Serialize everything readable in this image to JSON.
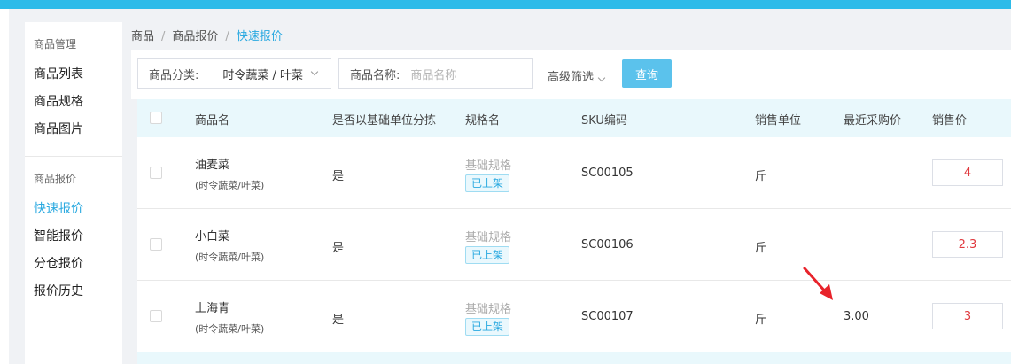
{
  "sidebar": {
    "group1": "商品管理",
    "items1": [
      "商品列表",
      "商品规格",
      "商品图片"
    ],
    "group2": "商品报价",
    "items2": [
      "快速报价",
      "智能报价",
      "分仓报价",
      "报价历史"
    ]
  },
  "breadcrumb": [
    "商品",
    "商品报价",
    "快速报价"
  ],
  "filters": {
    "category_label": "商品分类:",
    "category_value": "时令蔬菜 / 叶菜",
    "name_label": "商品名称:",
    "name_placeholder": "商品名称",
    "advanced": "高级筛选",
    "query_button": "查询"
  },
  "table": {
    "headers": [
      "商品名",
      "是否以基础单位分拣",
      "规格名",
      "SKU编码",
      "销售单位",
      "最近采购价",
      "销售价"
    ],
    "rows": [
      {
        "name": "油麦菜",
        "category": "(时令蔬菜/叶菜)",
        "base_sort": "是",
        "spec": "基础规格",
        "status": "已上架",
        "sku": "SC00105",
        "unit": "斤",
        "last_purchase": "",
        "price": "4"
      },
      {
        "name": "小白菜",
        "category": "(时令蔬菜/叶菜)",
        "base_sort": "是",
        "spec": "基础规格",
        "status": "已上架",
        "sku": "SC00106",
        "unit": "斤",
        "last_purchase": "",
        "price": "2.3"
      },
      {
        "name": "上海青",
        "category": "(时令蔬菜/叶菜)",
        "base_sort": "是",
        "spec": "基础规格",
        "status": "已上架",
        "sku": "SC00107",
        "unit": "斤",
        "last_purchase": "3.00",
        "price": "3"
      }
    ]
  },
  "colors": {
    "accent": "#2aa9e0",
    "topbar": "#2dbbe9",
    "price": "#e0393e",
    "arrow": "#e8232b"
  }
}
